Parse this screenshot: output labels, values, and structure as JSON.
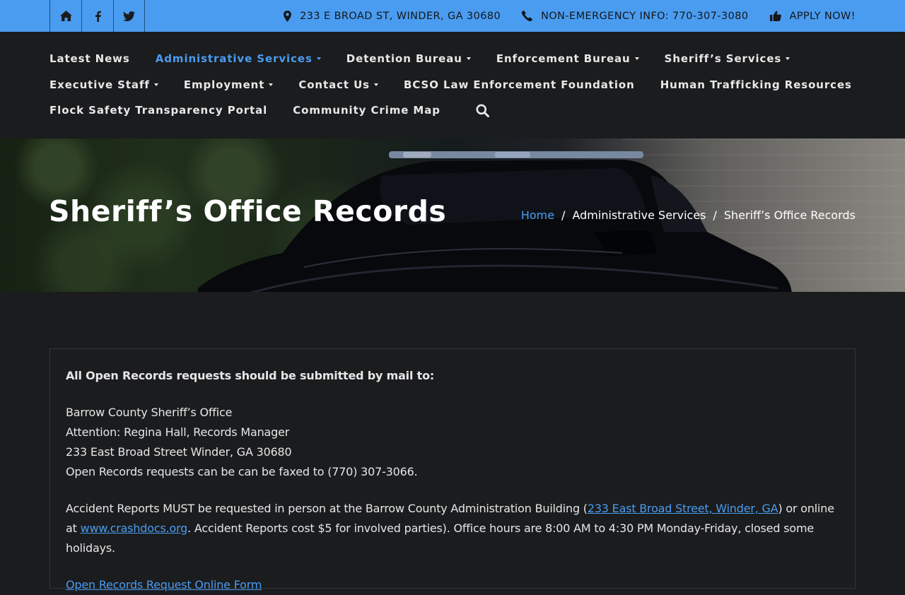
{
  "topbar": {
    "social": [
      {
        "name": "home-icon"
      },
      {
        "name": "facebook-icon"
      },
      {
        "name": "twitter-icon"
      }
    ],
    "address": "233 E BROAD ST, WINDER, GA 30680",
    "phone": "NON-EMERGENCY INFO: 770-307-3080",
    "apply": "APPLY NOW!",
    "colors": {
      "bar": "#4a9cf0",
      "text": "#15171a"
    }
  },
  "nav": {
    "row1": [
      {
        "label": "Latest News",
        "dropdown": false,
        "active": false
      },
      {
        "label": "Administrative Services",
        "dropdown": true,
        "active": true
      },
      {
        "label": "Detention Bureau",
        "dropdown": true,
        "active": false
      },
      {
        "label": "Enforcement Bureau",
        "dropdown": true,
        "active": false
      },
      {
        "label": "Sheriff’s Services",
        "dropdown": true,
        "active": false
      }
    ],
    "row2": [
      {
        "label": "Executive Staff",
        "dropdown": true,
        "active": false
      },
      {
        "label": "Employment",
        "dropdown": true,
        "active": false
      },
      {
        "label": "Contact Us",
        "dropdown": true,
        "active": false
      },
      {
        "label": "BCSO Law Enforcement Foundation",
        "dropdown": false,
        "active": false
      },
      {
        "label": "Human Trafficking Resources",
        "dropdown": false,
        "active": false
      }
    ],
    "row3": [
      {
        "label": "Flock Safety Transparency Portal",
        "dropdown": false,
        "active": false
      },
      {
        "label": "Community Crime Map",
        "dropdown": false,
        "active": false
      }
    ],
    "search_icon": "search-icon",
    "colors": {
      "link": "#e8e8e8",
      "active": "#4a9cf0"
    }
  },
  "hero": {
    "title": "Sheriff’s Office Records",
    "breadcrumb": {
      "home": "Home",
      "sep": "/",
      "parent": "Administrative Services",
      "current": "Sheriff’s Office Records"
    }
  },
  "content": {
    "intro": "All Open Records requests should be submitted by mail to:",
    "address_lines": [
      "Barrow County Sheriff’s Office",
      "Attention: Regina Hall, Records Manager",
      "233 East Broad Street Winder, GA 30680",
      "Open Records requests can be can be faxed to (770) 307-3066."
    ],
    "accident": {
      "pre": "Accident Reports MUST be requested in person at the Barrow County Administration Building (",
      "link1": "233 East Broad Street, Winder, GA",
      "mid": ") or online at",
      "link2": "www.crashdocs.org",
      "post": ". Accident Reports cost $5 for involved parties). Office hours are 8:00 AM to 4:30 PM Monday-Friday, closed some holidays."
    },
    "form_link": "Open Records Request Online Form"
  }
}
